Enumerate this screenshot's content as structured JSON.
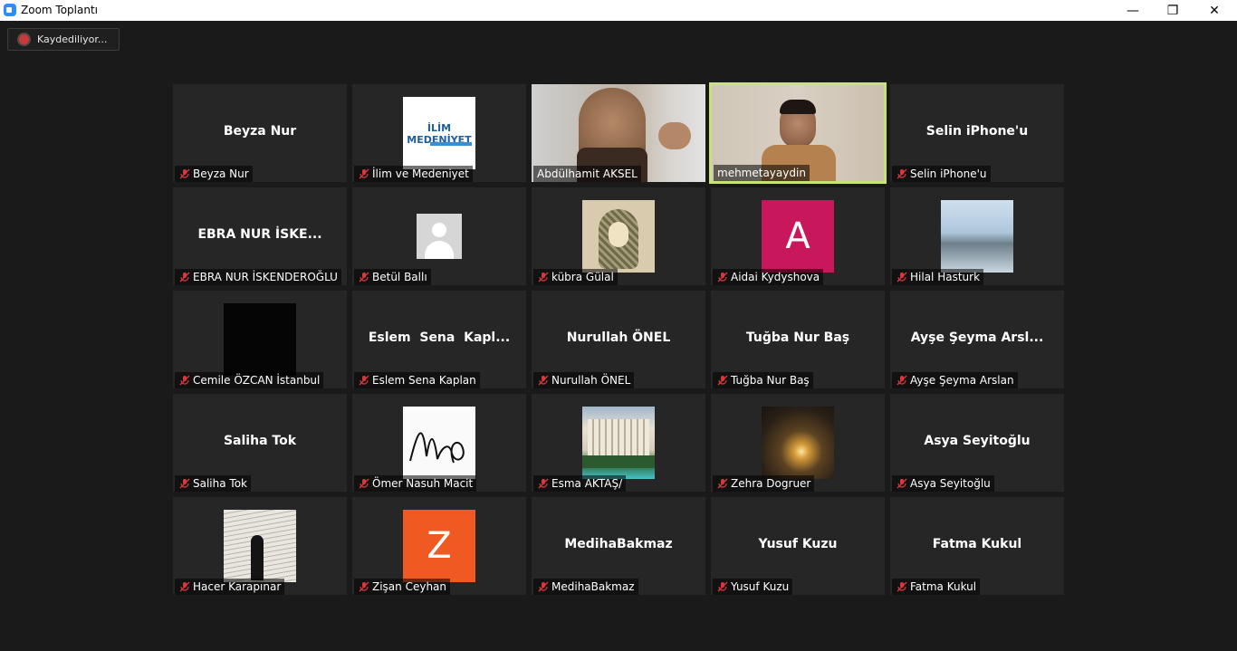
{
  "window": {
    "title": "Zoom Toplantı",
    "minimize": "—",
    "restore": "❐",
    "close": "✕"
  },
  "recording": {
    "label": "Kaydediliyor..."
  },
  "colors": {
    "accent_active": "#c7e37a",
    "mute_red": "#d9383a",
    "recording_red": "#c83a3a"
  },
  "tiles": [
    {
      "display": "Beyza Nur",
      "label": "Beyza Nur"
    },
    {
      "display": "İLİM MEDENİYET",
      "label": "İlim ve Medeniyet"
    },
    {
      "display": "",
      "label": "Abdülhamit AKSEL"
    },
    {
      "display": "",
      "label": "mehmetayaydin"
    },
    {
      "display": "Selin iPhone'u",
      "label": "Selin iPhone'u"
    },
    {
      "display": "EBRA NUR İSKE...",
      "label": "EBRA NUR İSKENDEROĞLU"
    },
    {
      "display": "",
      "label": "Betül Ballı"
    },
    {
      "display": "",
      "label": "kübra Gülal"
    },
    {
      "display": "A",
      "label": "Aidai Kydyshova"
    },
    {
      "display": "",
      "label": "Hilal Hasturk"
    },
    {
      "display": "",
      "label": "Cemile ÖZCAN İstanbul"
    },
    {
      "display": "Eslem  Sena  Kapl...",
      "label": "Eslem Sena Kaplan"
    },
    {
      "display": "Nurullah ÖNEL",
      "label": "Nurullah ÖNEL"
    },
    {
      "display": "Tuğba Nur Baş",
      "label": "Tuğba Nur Baş"
    },
    {
      "display": "Ayşe Şeyma Arsl...",
      "label": "Ayşe Şeyma Arslan"
    },
    {
      "display": "Saliha Tok",
      "label": "Saliha Tok"
    },
    {
      "display": "",
      "label": "Ömer Nasuh Macit"
    },
    {
      "display": "",
      "label": "Esma AKTAŞ/"
    },
    {
      "display": "",
      "label": "Zehra Dogruer"
    },
    {
      "display": "Asya Seyitoğlu",
      "label": "Asya Seyitoğlu"
    },
    {
      "display": "",
      "label": "Hacer Karapınar"
    },
    {
      "display": "Z",
      "label": "Zişan Ceyhan"
    },
    {
      "display": "MedihaBakmaz",
      "label": "MedihaBakmaz"
    },
    {
      "display": "Yusuf Kuzu",
      "label": "Yusuf Kuzu"
    },
    {
      "display": "Fatma Kukul",
      "label": "Fatma Kukul"
    }
  ]
}
